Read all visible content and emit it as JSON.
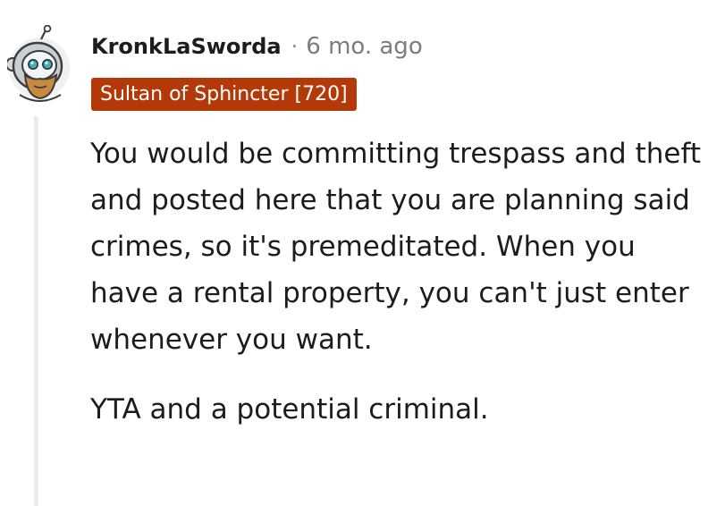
{
  "comment": {
    "author": "KronkLaSworda",
    "separator": "·",
    "timestamp": "6 mo. ago",
    "flair": "Sultan of Sphincter [720]",
    "paragraphs": [
      "You would be committing trespass and theft and posted here that you are planning said crimes, so it's premeditated. When you have a rental property, you can't just enter whenever you want.",
      "YTA and a potential criminal."
    ]
  },
  "icons": {
    "avatar": "snoo-astronaut-avatar-icon"
  },
  "colors": {
    "flair_background": "#b33a08",
    "flair_text": "#ffffff",
    "timestamp": "#7c7c7c",
    "thread_line": "#e9ebed",
    "text": "#1c1c1c"
  }
}
